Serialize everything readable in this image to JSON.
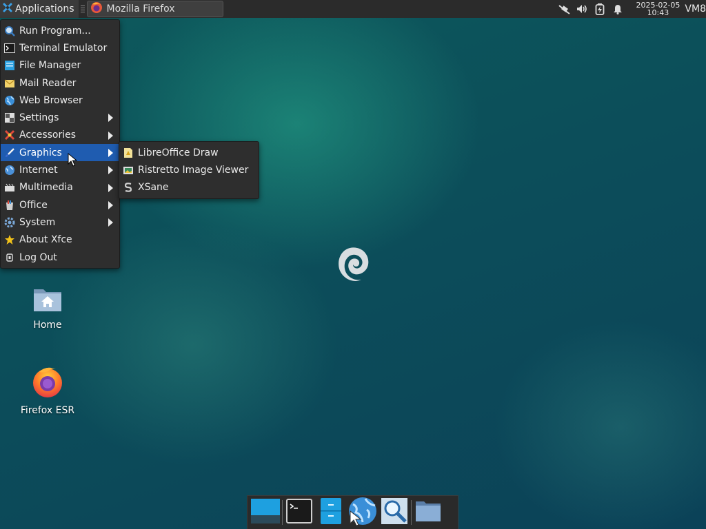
{
  "top_panel": {
    "applications_label": "Applications",
    "task_window_title": "Mozilla Firefox",
    "clock_date": "2025-02-05",
    "clock_time": "10:43",
    "vm_label": "VM8"
  },
  "main_menu": {
    "items": [
      {
        "label": "Run Program...",
        "icon": "run-program-icon"
      },
      {
        "label": "Terminal Emulator",
        "icon": "terminal-icon"
      },
      {
        "label": "File Manager",
        "icon": "file-manager-icon"
      },
      {
        "label": "Mail Reader",
        "icon": "mail-icon"
      },
      {
        "label": "Web Browser",
        "icon": "web-browser-icon"
      },
      {
        "label": "Settings",
        "icon": "settings-icon",
        "submenu": true
      },
      {
        "label": "Accessories",
        "icon": "accessories-icon",
        "submenu": true
      },
      {
        "label": "Graphics",
        "icon": "graphics-icon",
        "submenu": true,
        "active": true
      },
      {
        "label": "Internet",
        "icon": "internet-icon",
        "submenu": true
      },
      {
        "label": "Multimedia",
        "icon": "multimedia-icon",
        "submenu": true
      },
      {
        "label": "Office",
        "icon": "office-icon",
        "submenu": true
      },
      {
        "label": "System",
        "icon": "system-icon",
        "submenu": true
      },
      {
        "label": "About Xfce",
        "icon": "star-icon"
      },
      {
        "label": "Log Out",
        "icon": "logout-icon"
      }
    ]
  },
  "graphics_submenu": {
    "items": [
      {
        "label": "LibreOffice Draw",
        "icon": "libreoffice-draw-icon"
      },
      {
        "label": "Ristretto Image Viewer",
        "icon": "image-viewer-icon"
      },
      {
        "label": "XSane",
        "icon": "xsane-icon"
      }
    ]
  },
  "desktop": {
    "home_label": "Home",
    "firefox_label": "Firefox ESR"
  },
  "dock": {
    "items": [
      "show-desktop-icon",
      "terminal-icon",
      "file-manager-icon",
      "web-browser-icon",
      "app-finder-icon",
      "folder-icon"
    ]
  },
  "colors": {
    "panel": "#2b2b2b",
    "menu_bg": "#2e2e2e",
    "menu_highlight": "#1f5cb0",
    "desktop": "#0c4e5a"
  }
}
